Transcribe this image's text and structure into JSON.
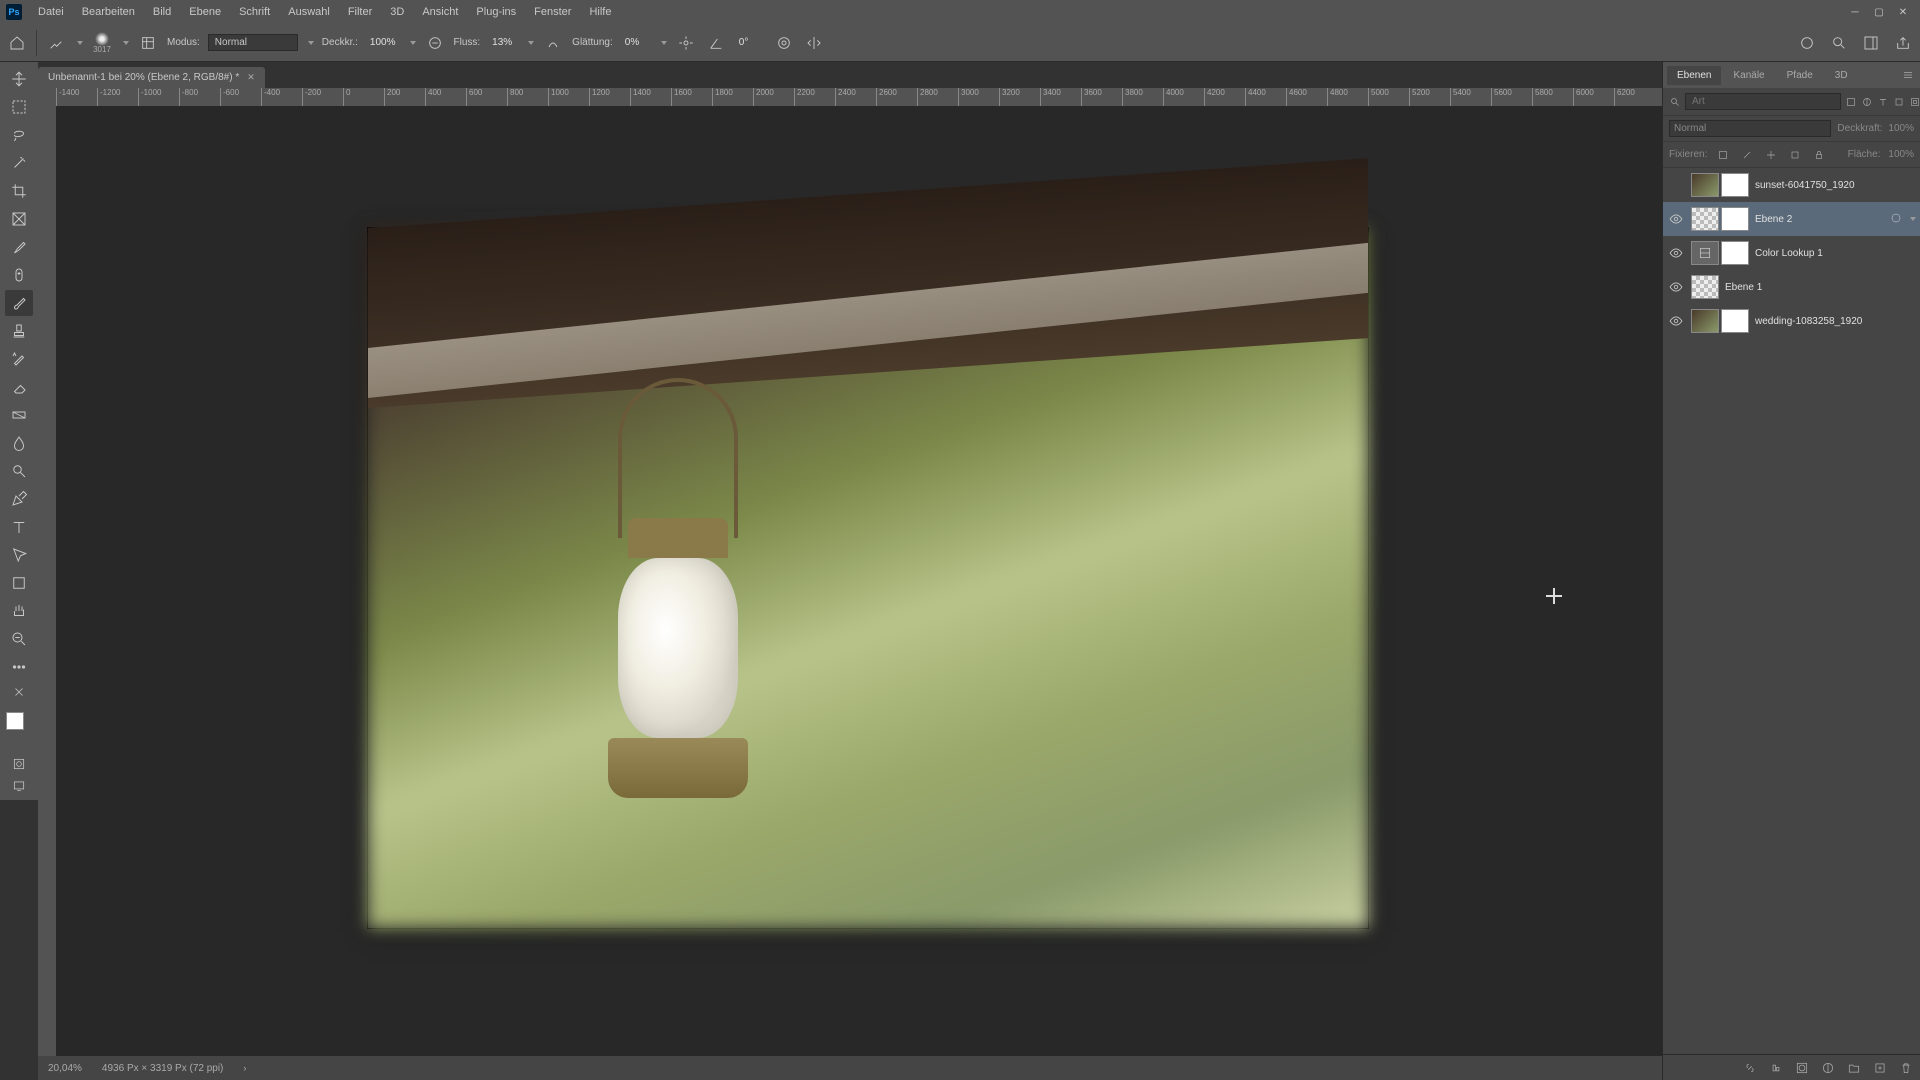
{
  "menubar": {
    "items": [
      "Datei",
      "Bearbeiten",
      "Bild",
      "Ebene",
      "Schrift",
      "Auswahl",
      "Filter",
      "3D",
      "Ansicht",
      "Plug-ins",
      "Fenster",
      "Hilfe"
    ]
  },
  "options": {
    "brush_size": "3017",
    "mode_label": "Modus:",
    "mode_value": "Normal",
    "opacity_label": "Deckkr.:",
    "opacity_value": "100%",
    "flow_label": "Fluss:",
    "flow_value": "13%",
    "smoothing_label": "Glättung:",
    "smoothing_value": "0%",
    "angle_icon": "angle",
    "angle_value": "0°"
  },
  "document": {
    "tab_title": "Unbenannt-1 bei 20% (Ebene 2, RGB/8#) *"
  },
  "ruler_ticks": [
    "-1400",
    "-1200",
    "-1000",
    "-800",
    "-600",
    "-400",
    "-200",
    "0",
    "200",
    "400",
    "600",
    "800",
    "1000",
    "1200",
    "1400",
    "1600",
    "1800",
    "2000",
    "2200",
    "2400",
    "2600",
    "2800",
    "3000",
    "3200",
    "3400",
    "3600",
    "3800",
    "4000",
    "4200",
    "4400",
    "4600",
    "4800",
    "5000",
    "5200",
    "5400",
    "5600",
    "5800",
    "6000",
    "6200"
  ],
  "panels": {
    "tabs": [
      "Ebenen",
      "Kanäle",
      "Pfade",
      "3D"
    ],
    "filter_placeholder": "Art",
    "blend_mode": "Normal",
    "opacity_label": "Deckkraft:",
    "opacity_val": "100%",
    "lock_label": "Fixieren:",
    "fill_label": "Fläche:",
    "fill_val": "100%"
  },
  "layers": [
    {
      "name": "sunset-6041750_1920",
      "visible": false,
      "selected": false,
      "thumbs": [
        "img",
        "mask"
      ]
    },
    {
      "name": "Ebene 2",
      "visible": true,
      "selected": true,
      "thumbs": [
        "check",
        "mask"
      ]
    },
    {
      "name": "Color Lookup 1",
      "visible": true,
      "selected": false,
      "thumbs": [
        "adj",
        "mask"
      ]
    },
    {
      "name": "Ebene 1",
      "visible": true,
      "selected": false,
      "thumbs": [
        "check"
      ]
    },
    {
      "name": "wedding-1083258_1920",
      "visible": true,
      "selected": false,
      "thumbs": [
        "img",
        "mask"
      ]
    }
  ],
  "status": {
    "zoom": "20,04%",
    "dims": "4936 Px × 3319 Px (72 ppi)"
  }
}
